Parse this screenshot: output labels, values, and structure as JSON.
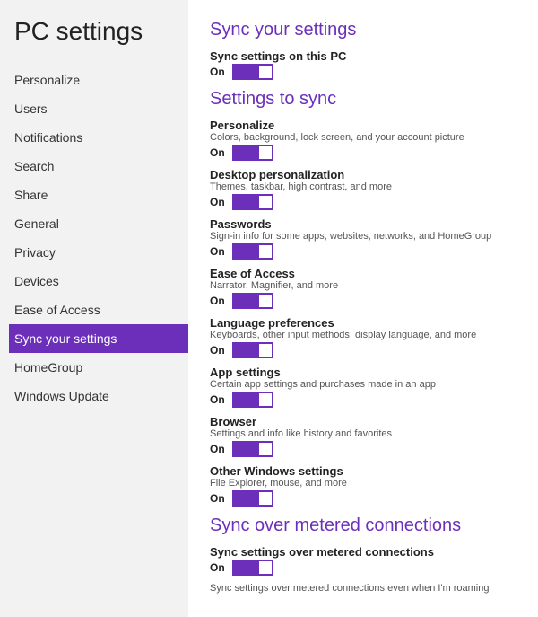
{
  "sidebar": {
    "title": "PC settings",
    "items": [
      {
        "id": "personalize",
        "label": "Personalize",
        "active": false
      },
      {
        "id": "users",
        "label": "Users",
        "active": false
      },
      {
        "id": "notifications",
        "label": "Notifications",
        "active": false
      },
      {
        "id": "search",
        "label": "Search",
        "active": false
      },
      {
        "id": "share",
        "label": "Share",
        "active": false
      },
      {
        "id": "general",
        "label": "General",
        "active": false
      },
      {
        "id": "privacy",
        "label": "Privacy",
        "active": false
      },
      {
        "id": "devices",
        "label": "Devices",
        "active": false
      },
      {
        "id": "ease-of-access",
        "label": "Ease of Access",
        "active": false
      },
      {
        "id": "sync-your-settings",
        "label": "Sync your settings",
        "active": true
      },
      {
        "id": "homegroup",
        "label": "HomeGroup",
        "active": false
      },
      {
        "id": "windows-update",
        "label": "Windows Update",
        "active": false
      }
    ]
  },
  "main": {
    "sections": [
      {
        "id": "sync-your-settings",
        "title": "Sync your settings",
        "items": [
          {
            "id": "sync-settings-this-pc",
            "label": "Sync settings on this PC",
            "desc": "",
            "toggle": "On"
          }
        ]
      },
      {
        "id": "settings-to-sync",
        "title": "Settings to sync",
        "items": [
          {
            "id": "personalize",
            "label": "Personalize",
            "desc": "Colors, background, lock screen, and your account picture",
            "toggle": "On"
          },
          {
            "id": "desktop-personalization",
            "label": "Desktop personalization",
            "desc": "Themes, taskbar, high contrast, and more",
            "toggle": "On"
          },
          {
            "id": "passwords",
            "label": "Passwords",
            "desc": "Sign-in info for some apps, websites, networks, and HomeGroup",
            "toggle": "On"
          },
          {
            "id": "ease-of-access",
            "label": "Ease of Access",
            "desc": "Narrator, Magnifier, and more",
            "toggle": "On"
          },
          {
            "id": "language-preferences",
            "label": "Language preferences",
            "desc": "Keyboards, other input methods, display language, and more",
            "toggle": "On"
          },
          {
            "id": "app-settings",
            "label": "App settings",
            "desc": "Certain app settings and purchases made in an app",
            "toggle": "On"
          },
          {
            "id": "browser",
            "label": "Browser",
            "desc": "Settings and info like history and favorites",
            "toggle": "On"
          },
          {
            "id": "other-windows-settings",
            "label": "Other Windows settings",
            "desc": "File Explorer, mouse, and more",
            "toggle": "On"
          }
        ]
      },
      {
        "id": "sync-over-metered",
        "title": "Sync over metered connections",
        "items": [
          {
            "id": "sync-metered",
            "label": "Sync settings over metered connections",
            "desc": "",
            "toggle": "On"
          },
          {
            "id": "sync-metered-roaming",
            "label": "Sync settings over metered connections even when I'm roaming",
            "desc": "",
            "toggle": null
          }
        ]
      }
    ]
  }
}
